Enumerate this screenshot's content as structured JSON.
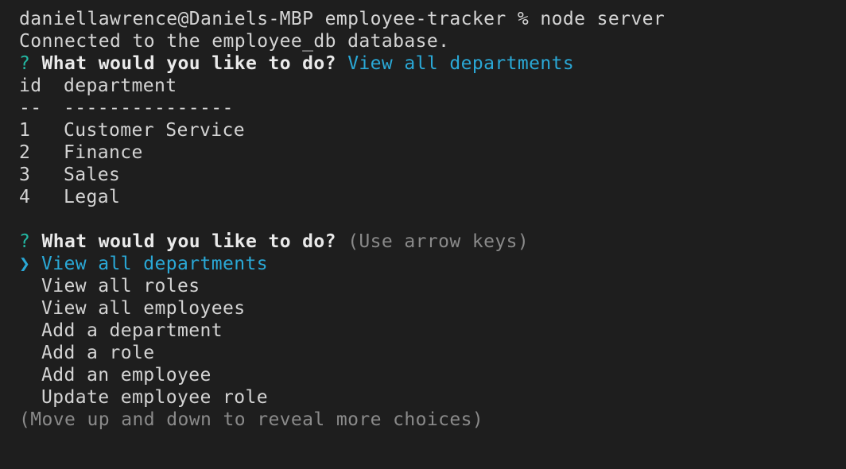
{
  "terminal": {
    "command_line": "daniellawrence@Daniels-MBP employee-tracker % node server",
    "connected_msg": "Connected to the employee_db database.",
    "prompt1": {
      "qmark": "?",
      "message": "What would you like to do?",
      "answer": "View all departments"
    },
    "table": {
      "headers": {
        "id": "id",
        "name": "department"
      },
      "separator": {
        "id": "--",
        "name": "---------------"
      },
      "rows": [
        {
          "id": "1",
          "name": "Customer Service"
        },
        {
          "id": "2",
          "name": "Finance"
        },
        {
          "id": "3",
          "name": "Sales"
        },
        {
          "id": "4",
          "name": "Legal"
        }
      ]
    },
    "prompt2": {
      "qmark": "?",
      "message": "What would you like to do?",
      "hint": "(Use arrow keys)",
      "pointer": "❯",
      "choices": [
        "View all departments",
        "View all roles",
        "View all employees",
        "Add a department",
        "Add a role",
        "Add an employee",
        "Update employee role"
      ],
      "selected_index": 0,
      "footer_hint": "(Move up and down to reveal more choices)"
    }
  }
}
